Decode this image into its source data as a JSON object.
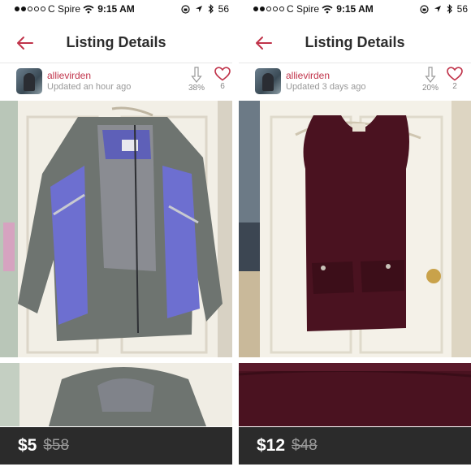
{
  "status": {
    "carrier": "C Spire",
    "time": "9:15 AM",
    "battery": "56"
  },
  "nav": {
    "title": "Listing Details"
  },
  "listings": [
    {
      "seller": "allievirden",
      "updated": "Updated an hour ago",
      "price_drop": "38%",
      "likes": "6",
      "price": "$5",
      "original_price": "$58"
    },
    {
      "seller": "allievirden",
      "updated": "Updated 3 days ago",
      "price_drop": "20%",
      "likes": "2",
      "price": "$12",
      "original_price": "$48"
    }
  ],
  "colors": {
    "accent": "#c0334a",
    "price_bar": "#2b2b2b",
    "jacket_blue": "#6d6fd0",
    "jacket_gray": "#6e7470",
    "dress": "#4a1220"
  },
  "icons": [
    "back-arrow-icon",
    "price-drop-arrow-icon",
    "heart-icon",
    "wifi-icon",
    "bluetooth-icon",
    "location-icon",
    "lock-rotation-icon"
  ]
}
